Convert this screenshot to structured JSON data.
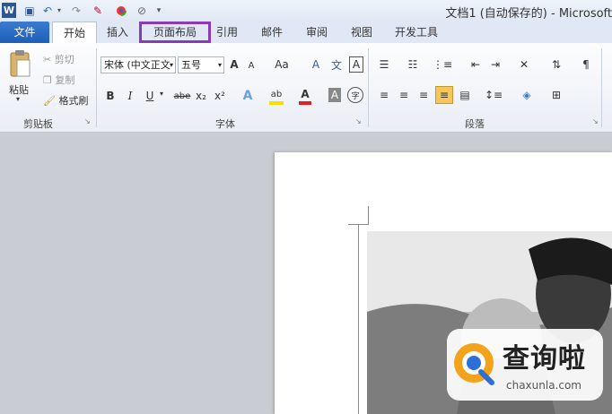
{
  "window": {
    "title": "文档1 (自动保存的) - Microsoft"
  },
  "quick_access": {
    "word_logo": "W",
    "save": "💾",
    "undo": "↶",
    "redo": "↷"
  },
  "tabs": [
    {
      "label": "文件"
    },
    {
      "label": "开始"
    },
    {
      "label": "插入"
    },
    {
      "label": "页面布局"
    },
    {
      "label": "引用"
    },
    {
      "label": "邮件"
    },
    {
      "label": "审阅"
    },
    {
      "label": "视图"
    },
    {
      "label": "开发工具"
    }
  ],
  "clipboard": {
    "paste": "粘贴",
    "cut": "剪切",
    "copy": "复制",
    "format_painter": "格式刷",
    "group_label": "剪贴板"
  },
  "font": {
    "family": "宋体 (中文正文",
    "size": "五号",
    "group_label": "字体",
    "grow": "A",
    "shrink": "A",
    "case": "Aa",
    "bold": "B",
    "italic": "I",
    "underline": "U",
    "strike": "abe",
    "sub": "x₂",
    "sup": "x²",
    "effects": "A",
    "highlight": "ab",
    "color": "A",
    "shading": "A",
    "enclose": "字",
    "pinyin": "文",
    "border": "A",
    "clear": "A"
  },
  "paragraph": {
    "group_label": "段落"
  },
  "watermark": {
    "brand": "查询啦",
    "domain": "chaxunla.com"
  },
  "colors": {
    "accent": "#1d5fb8",
    "highlight_box": "#8a3ab9",
    "active_align": "#f5c65b"
  }
}
